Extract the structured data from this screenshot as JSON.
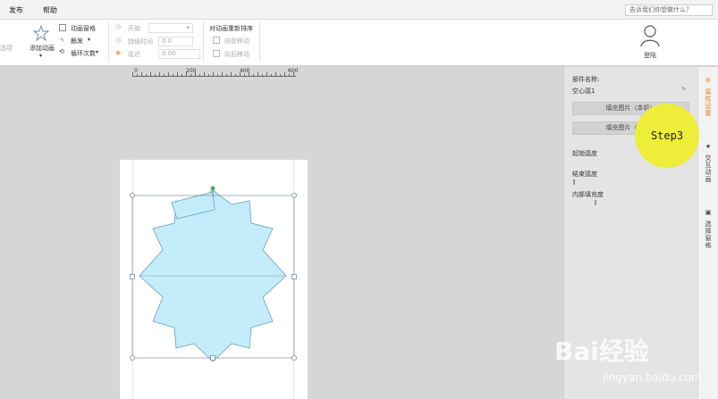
{
  "menu": {
    "items": [
      "发布",
      "帮助"
    ],
    "tell_me": "告诉我们你想做什么？"
  },
  "ribbon": {
    "left_cut": "选项",
    "add_animation": "添加动画",
    "animation_pane": "动画窗格",
    "trigger": "触发",
    "loop_count": "循环次数",
    "start": "开始",
    "duration": "持续时间",
    "duration_value": "0.0",
    "delay": "延迟",
    "delay_value": "0.00",
    "reorder": "对动画重新排序",
    "move_earlier": "向前移动",
    "move_later": "向后移动",
    "login": "登陆"
  },
  "ruler": {
    "labels": [
      "0",
      "200",
      "400",
      "600"
    ]
  },
  "panel": {
    "component_name_label": "部件名称:",
    "component_name_value": "空心弧1",
    "fill_local_btn": "填充图片（本机）",
    "fill_online_btn": "填充图片（联网）",
    "start_arc": "起始弧度",
    "end_arc": "结束弧度",
    "inner_fill": "内部填充度"
  },
  "side_tabs": {
    "properties": "属性设置",
    "interactive": "交互动画",
    "selection": "选择窗格"
  },
  "step_badge": "Step3",
  "watermark": {
    "brand": "Bai经验",
    "url": "jingyan.baidu.com"
  },
  "colors": {
    "accent": "#e67e22",
    "shape_fill": "#c5ecfb",
    "shape_stroke": "#6a9fb5",
    "step": "#eded3a"
  }
}
